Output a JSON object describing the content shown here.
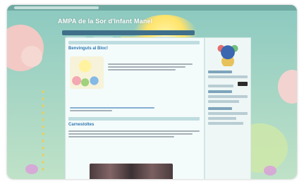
{
  "header": {
    "site_title": "AMPA de la Sor d'Infant Manel"
  },
  "nav": {
    "items": [
      "",
      "",
      "",
      "",
      ""
    ]
  },
  "posts": [
    {
      "title": "Benvinguts al Bloc!"
    },
    {
      "title": "Carnestoltes"
    }
  ],
  "colors": {
    "background": "#a9d7c5",
    "link_blue": "#2f79b0",
    "nav_bar": "#3f6f8a",
    "highlight_yellow": "#ffe270"
  }
}
